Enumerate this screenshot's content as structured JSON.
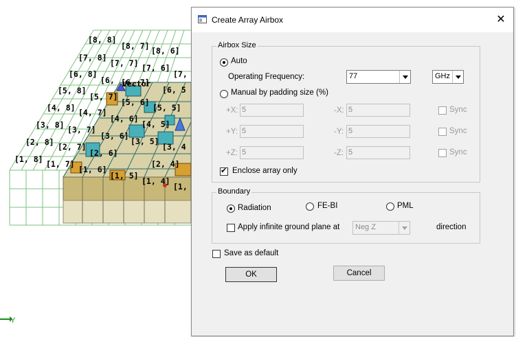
{
  "viewport": {
    "grid_labels": [
      "[8, 8]",
      "[8, 7]",
      "[8, 6]",
      "[7, 8]",
      "[7, 7]",
      "[7, 6]",
      "[7,",
      "[6, 8]",
      "[6,",
      "[6, 7]",
      "[6, 5",
      "[5, 8]",
      "[5, 7]",
      "[5, 6]",
      "[5, 5]",
      "[4, 8]",
      "[4, 7]",
      "[4, 6]",
      "[4, 5]",
      "[3, 8]",
      "[3, 7]",
      "[3, 6]",
      "[3, 5]",
      "[3, 4",
      "[2, 8]",
      "[2, 7]",
      "[2, 6]",
      "[2, 4]",
      "[1, 8]",
      "[1, 7]",
      "[1, 6]",
      "[1, 5]",
      "[1, 4]",
      "[1,"
    ],
    "overlay_text": "Vector",
    "axis_label": "Y"
  },
  "dialog": {
    "title": "Create Array Airbox",
    "close": "✕",
    "airbox_size": {
      "legend": "Airbox Size",
      "auto_label": "Auto",
      "freq_label": "Operating Frequency:",
      "freq_value": "77",
      "freq_unit": "GHz",
      "manual_label": "Manual by padding size (%)",
      "rows": [
        {
          "plus": "+X:",
          "plus_val": "5",
          "minus": "-X:",
          "minus_val": "5",
          "sync": "Sync"
        },
        {
          "plus": "+Y:",
          "plus_val": "5",
          "minus": "-Y:",
          "minus_val": "5",
          "sync": "Sync"
        },
        {
          "plus": "+Z:",
          "plus_val": "5",
          "minus": "-Z:",
          "minus_val": "5",
          "sync": "Sync"
        }
      ],
      "enclose_label": "Enclose array only"
    },
    "boundary": {
      "legend": "Boundary",
      "radiation": "Radiation",
      "febi": "FE-BI",
      "pml": "PML",
      "ground_label": "Apply infinite ground plane at",
      "ground_value": "Neg Z",
      "direction": "direction"
    },
    "save_default": "Save as default",
    "ok": "OK",
    "cancel": "Cancel"
  }
}
